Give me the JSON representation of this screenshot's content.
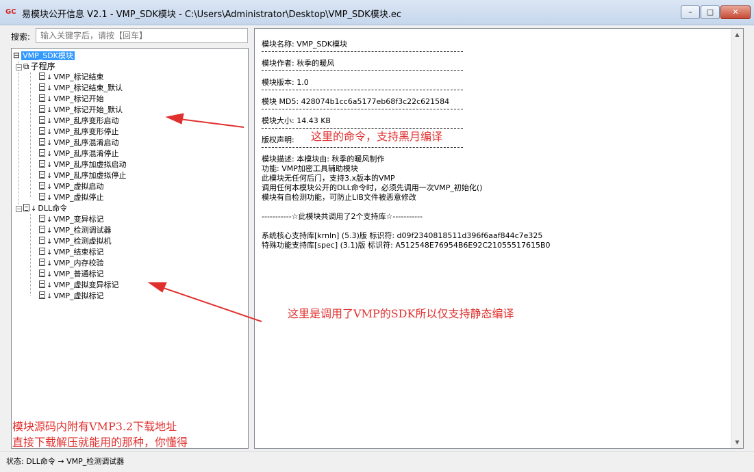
{
  "window": {
    "title": "易模块公开信息 V2.1 - VMP_SDK模块 - C:\\Users\\Administrator\\Desktop\\VMP_SDK模块.ec",
    "icon_text": "GC",
    "min_glyph": "–",
    "max_glyph": "□",
    "close_glyph": "✕"
  },
  "search": {
    "label": "搜索:",
    "placeholder": "输入关键字后，请按【回车】"
  },
  "tree": {
    "root": "VMP_SDK模块",
    "group1": {
      "label": "子程序",
      "items": [
        "VMP_标记结束",
        "VMP_标记结束_默认",
        "VMP_标记开始",
        "VMP_标记开始_默认",
        "VMP_乱序变形启动",
        "VMP_乱序变形停止",
        "VMP_乱序混淆启动",
        "VMP_乱序混淆停止",
        "VMP_乱序加虚拟启动",
        "VMP_乱序加虚拟停止",
        "VMP_虚拟启动",
        "VMP_虚拟停止"
      ]
    },
    "group2": {
      "label": "DLL命令",
      "items": [
        "VMP_变异标记",
        "VMP_检测调试器",
        "VMP_检测虚拟机",
        "VMP_结束标记",
        "VMP_内存校验",
        "VMP_普通标记",
        "VMP_虚拟变异标记",
        "VMP_虚拟标记"
      ]
    }
  },
  "info": {
    "name": "模块名称: VMP_SDK模块",
    "author": "模块作者: 秋季的暖风",
    "version": "模块版本: 1.0",
    "md5": "模块 MD5: 428074b1cc6a5177eb68f3c22c621584",
    "size": "模块大小: 14.43 KB",
    "copyright": "版权声明:",
    "desc_lines": [
      "模块描述: 本模块由: 秋季的暖风制作",
      "功能: VMP加密工具辅助模块",
      "此模块无任何后门，支持3.x版本的VMP",
      "调用任何本模块公开的DLL命令时，必须先调用一次VMP_初始化()",
      "模块有自检测功能，可防止LIB文件被恶意修改"
    ],
    "libs_header": "-----------☆此模块共调用了2个支持库☆-----------",
    "lib_lines": [
      "系统核心支持库[krnln] (5.3)版 标识符: d09f2340818511d396f6aaf844c7e325",
      "特殊功能支持库[spec] (3.1)版 标识符: A512548E76954B6E92C21055517615B0"
    ]
  },
  "annotations": {
    "a1": "这里的命令，支持黑月编译",
    "a2": "这里是调用了VMP的SDK所以仅支持静态编译",
    "a3_line1": "模块源码内附有VMP3.2下载地址",
    "a3_line2": "直接下载解压就能用的那种，你懂得",
    "color": "#e0302e"
  },
  "status": {
    "text": "状态: DLL命令 → VMP_检测调试器"
  }
}
